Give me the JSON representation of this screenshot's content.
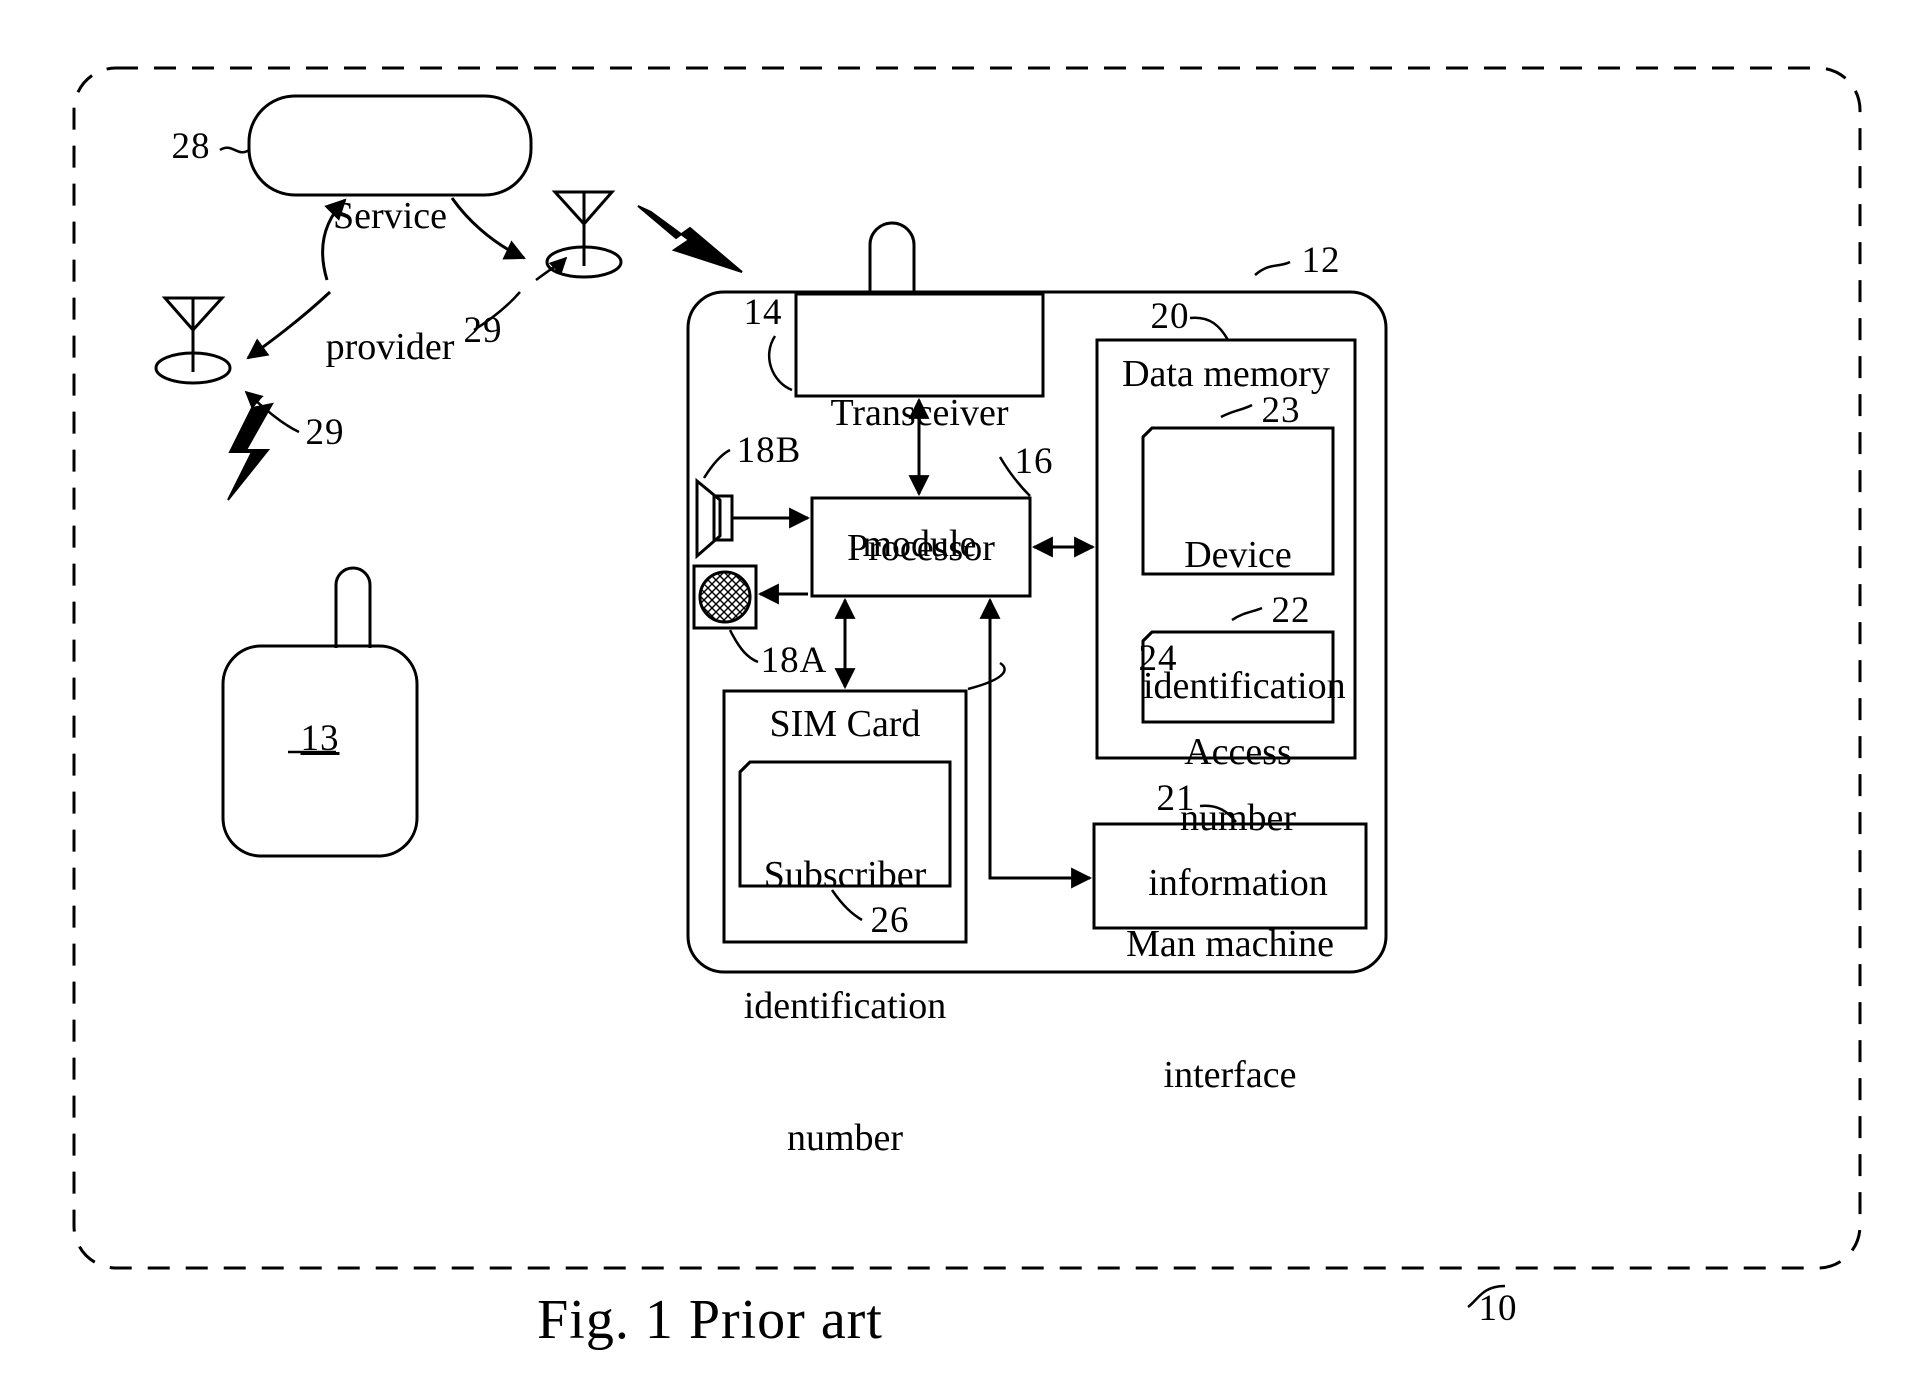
{
  "figure": {
    "caption": "Fig. 1 Prior art",
    "outer_ref": "10"
  },
  "nodes": {
    "service_provider": {
      "label": "Service\nprovider",
      "ref": "28"
    },
    "mobile_device_left": {
      "ref": "13"
    },
    "handset": {
      "ref": "12"
    },
    "transceiver_module": {
      "label": "Transceiver\nmodule",
      "ref": "14"
    },
    "processor": {
      "label": "Processor",
      "ref": "16"
    },
    "data_memory": {
      "label": "Data memory",
      "ref": "20"
    },
    "device_identification_number": {
      "label": "Device\nidentification\nnumber",
      "ref": "23"
    },
    "access_information": {
      "label": "Access\ninformation",
      "ref": "22"
    },
    "sim_card": {
      "label": "SIM Card",
      "ref": "24"
    },
    "subscriber_identification_number": {
      "label": "Subscriber\nidentification\nnumber",
      "ref": "26"
    },
    "man_machine_interface": {
      "label": "Man machine\ninterface",
      "ref": "21"
    },
    "speaker": {
      "ref": "18B"
    },
    "microphone": {
      "ref": "18A"
    },
    "base_station_left": {
      "ref": "29"
    },
    "base_station_right": {
      "ref": "29"
    },
    "base_station_third": {
      "ref": "29"
    }
  },
  "labels": {
    "service_provider_line1": "Service",
    "service_provider_line2": "provider",
    "transceiver_line1": "Transceiver",
    "transceiver_line2": "module",
    "processor": "Processor",
    "data_memory": "Data memory",
    "device_id_line1": "Device",
    "device_id_line2": "identification",
    "device_id_line3": "number",
    "access_line1": "Access",
    "access_line2": "information",
    "sim_card": "SIM Card",
    "subscriber_line1": "Subscriber",
    "subscriber_line2": "identification",
    "subscriber_line3": "number",
    "mmi_line1": "Man machine",
    "mmi_line2": "interface"
  },
  "refs": {
    "r10": "10",
    "r12": "12",
    "r13": "13",
    "r14": "14",
    "r16": "16",
    "r18a": "18A",
    "r18b": "18B",
    "r20": "20",
    "r21": "21",
    "r22": "22",
    "r23": "23",
    "r24": "24",
    "r26": "26",
    "r28": "28",
    "r29a": "29",
    "r29b": "29",
    "r29c": "29"
  },
  "colors": {
    "stroke": "#000000",
    "background": "#ffffff"
  }
}
